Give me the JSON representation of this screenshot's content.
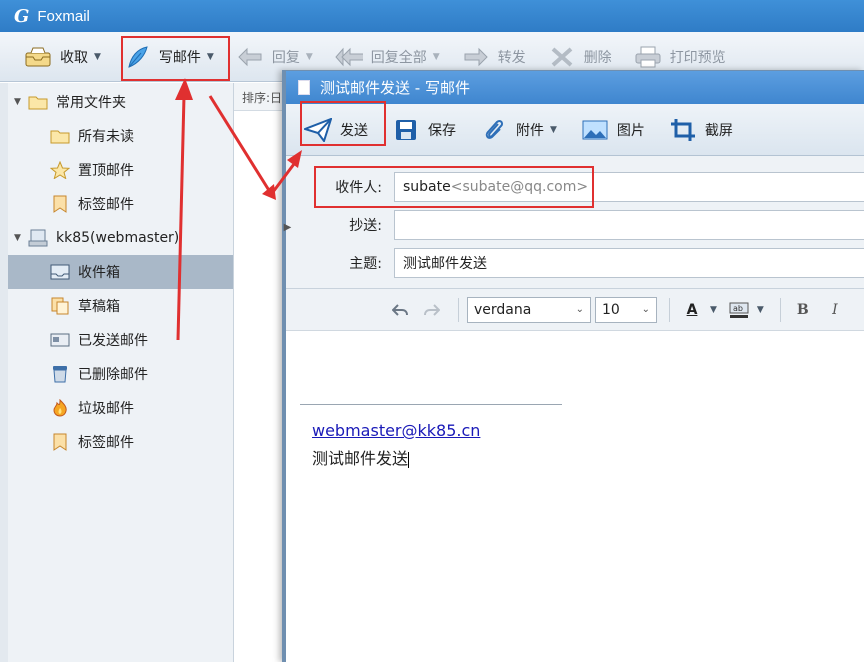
{
  "app": {
    "title": "Foxmail"
  },
  "toolbar": {
    "receive": "收取",
    "compose": "写邮件",
    "reply": "回复",
    "reply_all": "回复全部",
    "forward": "转发",
    "delete": "删除",
    "print_preview": "打印预览"
  },
  "sidebar": {
    "common_group": "常用文件夹",
    "common_items": [
      {
        "label": "所有未读"
      },
      {
        "label": "置顶邮件"
      },
      {
        "label": "标签邮件"
      }
    ],
    "account_group": "kk85(webmaster)",
    "account_items": [
      {
        "label": "收件箱"
      },
      {
        "label": "草稿箱"
      },
      {
        "label": "已发送邮件"
      },
      {
        "label": "已删除邮件"
      },
      {
        "label": "垃圾邮件"
      },
      {
        "label": "标签邮件"
      }
    ]
  },
  "list": {
    "sort_label": "排序:日"
  },
  "compose": {
    "title": "测试邮件发送 - 写邮件",
    "toolbar": {
      "send": "发送",
      "save": "保存",
      "attach": "附件",
      "image": "图片",
      "screenshot": "截屏"
    },
    "to_label": "收件人:",
    "to_name": "subate",
    "to_addr": "<subate@qq.com>",
    "cc_label": "抄送:",
    "cc_value": "",
    "subject_label": "主题:",
    "subject_value": "测试邮件发送",
    "font": "verdana",
    "font_size": "10",
    "signature_link": "webmaster@kk85.cn",
    "body_text": "测试邮件发送"
  },
  "colors": {
    "annotation": "#e03030",
    "title_bar": "#3f90d8",
    "link": "#1a1ab8"
  }
}
